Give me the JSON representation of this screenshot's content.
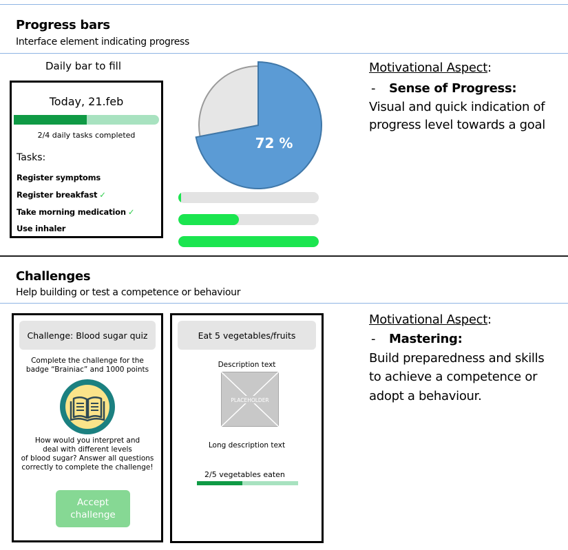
{
  "progress_section": {
    "title": "Progress bars",
    "subtitle": "Interface element indicating progress",
    "daily_caption": "Daily bar to fill",
    "daily_card": {
      "date": "Today,  21.feb",
      "progress_fraction": 0.5,
      "tasks_completed_text": "2/4 daily tasks completed",
      "tasks_label": "Tasks:",
      "tasks": [
        {
          "label": "Register symptoms",
          "done": false
        },
        {
          "label": "Register breakfast",
          "done": true
        },
        {
          "label": "Take morning medication",
          "done": true
        },
        {
          "label": "Use inhaler",
          "done": false
        }
      ],
      "check_glyph": "✓"
    },
    "pie": {
      "label": "72 %",
      "value": 72
    },
    "bars": [
      0.02,
      0.43,
      1.0
    ],
    "motivational": {
      "heading": "Motivational Aspect",
      "heading_colon": ":",
      "dash": "-",
      "point": "Sense of Progress:",
      "lines": [
        "Visual and quick indication of",
        "progress level towards a goal"
      ]
    }
  },
  "challenges_section": {
    "title": "Challenges",
    "subtitle": "Help building or test a competence or behaviour",
    "card1": {
      "header": "Challenge: Blood sugar quiz",
      "intro": [
        "Complete the challenge for the",
        "badge “Brainiac” and 1000 points"
      ],
      "icon": "book-badge-icon",
      "question": [
        "How would you interpret and",
        "deal with different levels",
        "of blood sugar? Answer all questions",
        "correctly to complete the challenge!"
      ],
      "button": [
        "Accept",
        "challenge"
      ]
    },
    "card2": {
      "header": "Eat 5 vegetables/fruits",
      "description": "Description text",
      "placeholder": "PLACEHOLDER",
      "long_description": "Long description text",
      "progress_text": "2/5 vegetables eaten",
      "progress_fraction": 0.45
    },
    "motivational": {
      "heading": "Motivational Aspect",
      "heading_colon": ":",
      "dash": "-",
      "point": "Mastering:",
      "lines": [
        "Build preparedness and skills",
        "to achieve a competence or",
        "adopt a behaviour."
      ]
    }
  },
  "colors": {
    "pie_fill": "#5b9bd5",
    "pie_rest": "#e6e6e6",
    "bar_green": "#1be54f",
    "dark_green": "#0f9a45",
    "light_green": "#a8e2c0",
    "badge_teal": "#1b8080",
    "badge_yellow": "#fbe48a",
    "button_green": "#86d894"
  }
}
